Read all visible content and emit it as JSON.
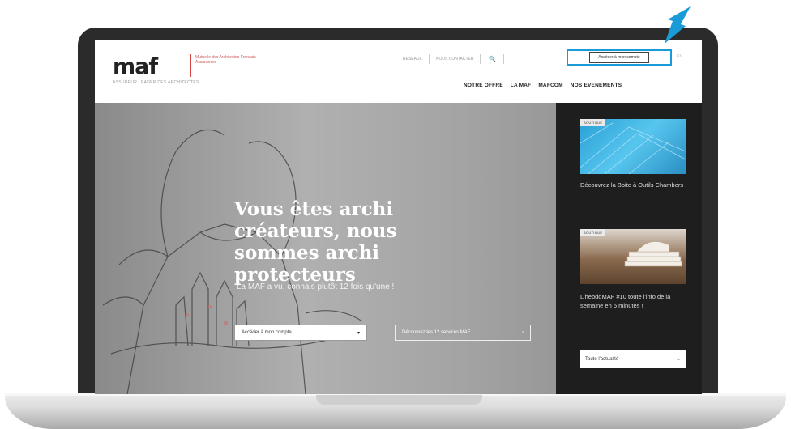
{
  "header": {
    "logo": "maf",
    "logo_subtitle": "Mutuelle des Architectes Français Assurances",
    "tagline": "ASSUREUR LEADER DES ARCHITECTES",
    "top_links": [
      "RESEAUX",
      "NOUS CONTACTER"
    ],
    "account_button": "Accéder à mon compte",
    "language": "EN",
    "nav": [
      "NOTRE OFFRE",
      "LA MAF",
      "MAFCOM",
      "NOS EVENEMENTS"
    ]
  },
  "hero": {
    "title": "Vous êtes archi créateurs, nous sommes archi protecteurs",
    "subtitle": "La MAF a vu, connais plutôt 12 fois qu'une !",
    "button_account": "Accéder à mon compte",
    "button_account_icon": "▾",
    "button_discover": "Découvrez les 12 services MAF",
    "button_discover_icon": "›"
  },
  "news": {
    "cards": [
      {
        "badge": "BOUTIQUE",
        "text": "Découvrez la Boite à Outils Chambers !"
      },
      {
        "badge": "BOUTIQUE",
        "text": "L'hebdoMAF #10 toute l'info de la semaine en 5 minutes !"
      }
    ],
    "all_news": "Toute l'actualité",
    "all_news_icon": "→"
  },
  "colors": {
    "accent": "#1a9ad6",
    "brand_red": "#d44",
    "panel": "#1e1e1e"
  }
}
